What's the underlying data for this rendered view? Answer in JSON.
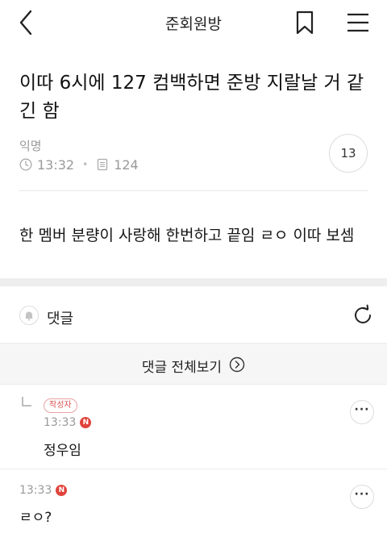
{
  "topbar": {
    "title": "준회원방",
    "icons": {
      "back": "back-chevron-icon",
      "bookmark": "bookmark-icon",
      "menu": "menu-icon"
    }
  },
  "post": {
    "title": "이따 6시에 127 컴백하면 준방 지랄날 거 같긴 함",
    "author": "익명",
    "time": "13:32",
    "views": "124",
    "comment_count": "13",
    "body": "한 멤버 분량이 사랑해 한번하고 끝임 ㄹㅇ 이따 보셈"
  },
  "comments_section": {
    "label": "댓글",
    "view_all": "댓글 전체보기"
  },
  "comments": [
    {
      "is_reply": true,
      "badge": "작성자",
      "time": "13:33",
      "new_mark": "N",
      "text": "정우임"
    },
    {
      "is_reply": false,
      "time": "13:33",
      "new_mark": "N",
      "text": "ㄹㅇ?"
    }
  ],
  "colors": {
    "accent_red": "#e0433b",
    "muted": "#9a9a9a",
    "section_bg": "#eeeeee"
  }
}
